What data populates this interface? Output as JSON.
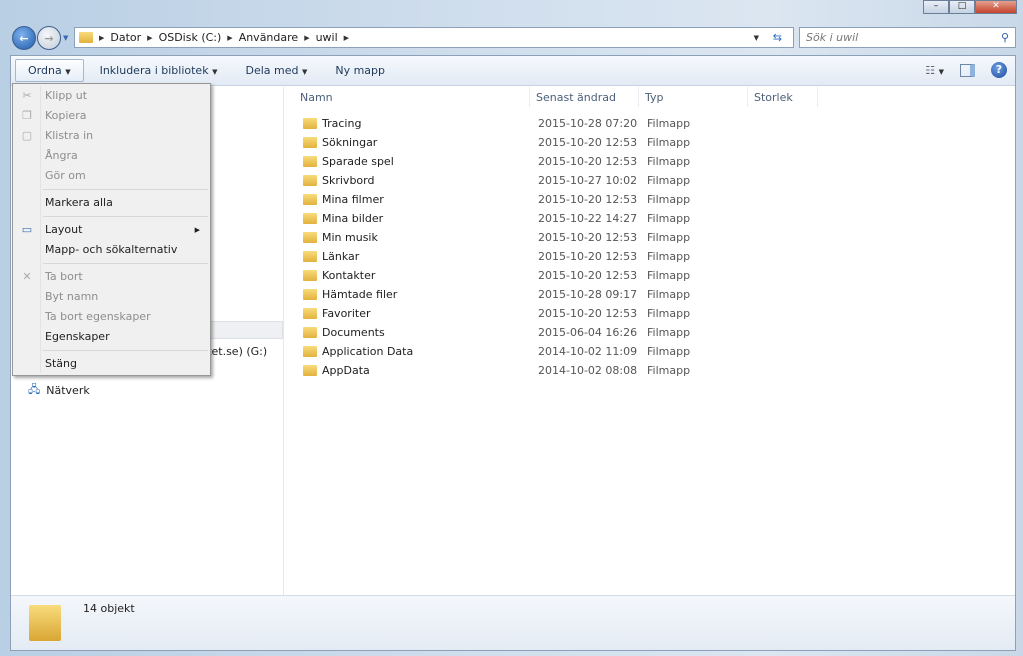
{
  "window": {
    "controls": [
      "minimize",
      "maximize",
      "close"
    ]
  },
  "address": {
    "crumbs": [
      "Dator",
      "OSDisk (C:)",
      "Användare",
      "uwil"
    ]
  },
  "search": {
    "placeholder": "Sök i uwil"
  },
  "toolbar": {
    "organize": "Ordna",
    "include": "Inkludera i bibliotek",
    "share": "Dela med",
    "new_folder": "Ny mapp"
  },
  "columns": [
    "Namn",
    "Senast ändrad",
    "Typ",
    "Storlek"
  ],
  "files": [
    {
      "name": "Tracing",
      "date": "2015-10-28 07:20",
      "type": "Filmapp"
    },
    {
      "name": "Sökningar",
      "date": "2015-10-20 12:53",
      "type": "Filmapp"
    },
    {
      "name": "Sparade spel",
      "date": "2015-10-20 12:53",
      "type": "Filmapp"
    },
    {
      "name": "Skrivbord",
      "date": "2015-10-27 10:02",
      "type": "Filmapp"
    },
    {
      "name": "Mina filmer",
      "date": "2015-10-20 12:53",
      "type": "Filmapp"
    },
    {
      "name": "Mina bilder",
      "date": "2015-10-22 14:27",
      "type": "Filmapp"
    },
    {
      "name": "Min musik",
      "date": "2015-10-20 12:53",
      "type": "Filmapp"
    },
    {
      "name": "Länkar",
      "date": "2015-10-20 12:53",
      "type": "Filmapp"
    },
    {
      "name": "Kontakter",
      "date": "2015-10-20 12:53",
      "type": "Filmapp"
    },
    {
      "name": "Hämtade filer",
      "date": "2015-10-28 09:17",
      "type": "Filmapp"
    },
    {
      "name": "Favoriter",
      "date": "2015-10-20 12:53",
      "type": "Filmapp"
    },
    {
      "name": "Documents",
      "date": "2015-06-04 16:26",
      "type": "Filmapp"
    },
    {
      "name": "Application Data",
      "date": "2014-10-02 11:09",
      "type": "Filmapp"
    },
    {
      "name": "AppData",
      "date": "2014-10-02 08:08",
      "type": "Filmapp"
    }
  ],
  "navpane": {
    "drive_partial": "rket.se) (G:)",
    "network": "Nätverk"
  },
  "status": {
    "count": "14 objekt"
  },
  "menu": {
    "items": [
      "Klipp ut",
      "Kopiera",
      "Klistra in",
      "Ångra",
      "Gör om",
      "Markera alla",
      "Layout",
      "Mapp- och sökalternativ",
      "Ta bort",
      "Byt namn",
      "Ta bort egenskaper",
      "Egenskaper",
      "Stäng"
    ]
  }
}
